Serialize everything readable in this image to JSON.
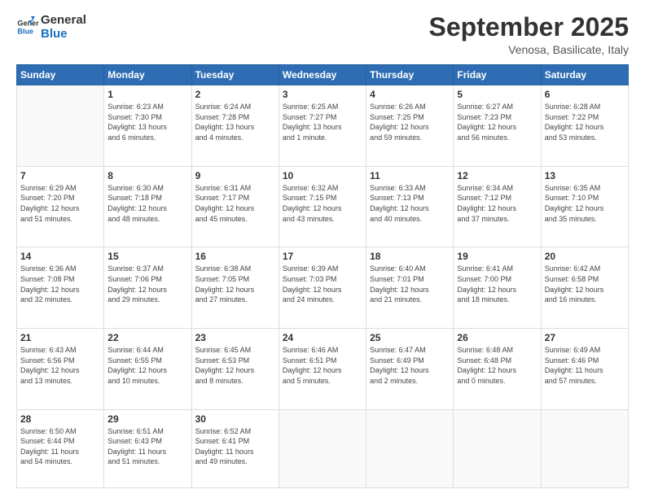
{
  "logo": {
    "line1": "General",
    "line2": "Blue"
  },
  "header": {
    "month": "September 2025",
    "location": "Venosa, Basilicate, Italy"
  },
  "weekdays": [
    "Sunday",
    "Monday",
    "Tuesday",
    "Wednesday",
    "Thursday",
    "Friday",
    "Saturday"
  ],
  "weeks": [
    [
      {
        "day": "",
        "info": ""
      },
      {
        "day": "1",
        "info": "Sunrise: 6:23 AM\nSunset: 7:30 PM\nDaylight: 13 hours\nand 6 minutes."
      },
      {
        "day": "2",
        "info": "Sunrise: 6:24 AM\nSunset: 7:28 PM\nDaylight: 13 hours\nand 4 minutes."
      },
      {
        "day": "3",
        "info": "Sunrise: 6:25 AM\nSunset: 7:27 PM\nDaylight: 13 hours\nand 1 minute."
      },
      {
        "day": "4",
        "info": "Sunrise: 6:26 AM\nSunset: 7:25 PM\nDaylight: 12 hours\nand 59 minutes."
      },
      {
        "day": "5",
        "info": "Sunrise: 6:27 AM\nSunset: 7:23 PM\nDaylight: 12 hours\nand 56 minutes."
      },
      {
        "day": "6",
        "info": "Sunrise: 6:28 AM\nSunset: 7:22 PM\nDaylight: 12 hours\nand 53 minutes."
      }
    ],
    [
      {
        "day": "7",
        "info": "Sunrise: 6:29 AM\nSunset: 7:20 PM\nDaylight: 12 hours\nand 51 minutes."
      },
      {
        "day": "8",
        "info": "Sunrise: 6:30 AM\nSunset: 7:18 PM\nDaylight: 12 hours\nand 48 minutes."
      },
      {
        "day": "9",
        "info": "Sunrise: 6:31 AM\nSunset: 7:17 PM\nDaylight: 12 hours\nand 45 minutes."
      },
      {
        "day": "10",
        "info": "Sunrise: 6:32 AM\nSunset: 7:15 PM\nDaylight: 12 hours\nand 43 minutes."
      },
      {
        "day": "11",
        "info": "Sunrise: 6:33 AM\nSunset: 7:13 PM\nDaylight: 12 hours\nand 40 minutes."
      },
      {
        "day": "12",
        "info": "Sunrise: 6:34 AM\nSunset: 7:12 PM\nDaylight: 12 hours\nand 37 minutes."
      },
      {
        "day": "13",
        "info": "Sunrise: 6:35 AM\nSunset: 7:10 PM\nDaylight: 12 hours\nand 35 minutes."
      }
    ],
    [
      {
        "day": "14",
        "info": "Sunrise: 6:36 AM\nSunset: 7:08 PM\nDaylight: 12 hours\nand 32 minutes."
      },
      {
        "day": "15",
        "info": "Sunrise: 6:37 AM\nSunset: 7:06 PM\nDaylight: 12 hours\nand 29 minutes."
      },
      {
        "day": "16",
        "info": "Sunrise: 6:38 AM\nSunset: 7:05 PM\nDaylight: 12 hours\nand 27 minutes."
      },
      {
        "day": "17",
        "info": "Sunrise: 6:39 AM\nSunset: 7:03 PM\nDaylight: 12 hours\nand 24 minutes."
      },
      {
        "day": "18",
        "info": "Sunrise: 6:40 AM\nSunset: 7:01 PM\nDaylight: 12 hours\nand 21 minutes."
      },
      {
        "day": "19",
        "info": "Sunrise: 6:41 AM\nSunset: 7:00 PM\nDaylight: 12 hours\nand 18 minutes."
      },
      {
        "day": "20",
        "info": "Sunrise: 6:42 AM\nSunset: 6:58 PM\nDaylight: 12 hours\nand 16 minutes."
      }
    ],
    [
      {
        "day": "21",
        "info": "Sunrise: 6:43 AM\nSunset: 6:56 PM\nDaylight: 12 hours\nand 13 minutes."
      },
      {
        "day": "22",
        "info": "Sunrise: 6:44 AM\nSunset: 6:55 PM\nDaylight: 12 hours\nand 10 minutes."
      },
      {
        "day": "23",
        "info": "Sunrise: 6:45 AM\nSunset: 6:53 PM\nDaylight: 12 hours\nand 8 minutes."
      },
      {
        "day": "24",
        "info": "Sunrise: 6:46 AM\nSunset: 6:51 PM\nDaylight: 12 hours\nand 5 minutes."
      },
      {
        "day": "25",
        "info": "Sunrise: 6:47 AM\nSunset: 6:49 PM\nDaylight: 12 hours\nand 2 minutes."
      },
      {
        "day": "26",
        "info": "Sunrise: 6:48 AM\nSunset: 6:48 PM\nDaylight: 12 hours\nand 0 minutes."
      },
      {
        "day": "27",
        "info": "Sunrise: 6:49 AM\nSunset: 6:46 PM\nDaylight: 11 hours\nand 57 minutes."
      }
    ],
    [
      {
        "day": "28",
        "info": "Sunrise: 6:50 AM\nSunset: 6:44 PM\nDaylight: 11 hours\nand 54 minutes."
      },
      {
        "day": "29",
        "info": "Sunrise: 6:51 AM\nSunset: 6:43 PM\nDaylight: 11 hours\nand 51 minutes."
      },
      {
        "day": "30",
        "info": "Sunrise: 6:52 AM\nSunset: 6:41 PM\nDaylight: 11 hours\nand 49 minutes."
      },
      {
        "day": "",
        "info": ""
      },
      {
        "day": "",
        "info": ""
      },
      {
        "day": "",
        "info": ""
      },
      {
        "day": "",
        "info": ""
      }
    ]
  ]
}
